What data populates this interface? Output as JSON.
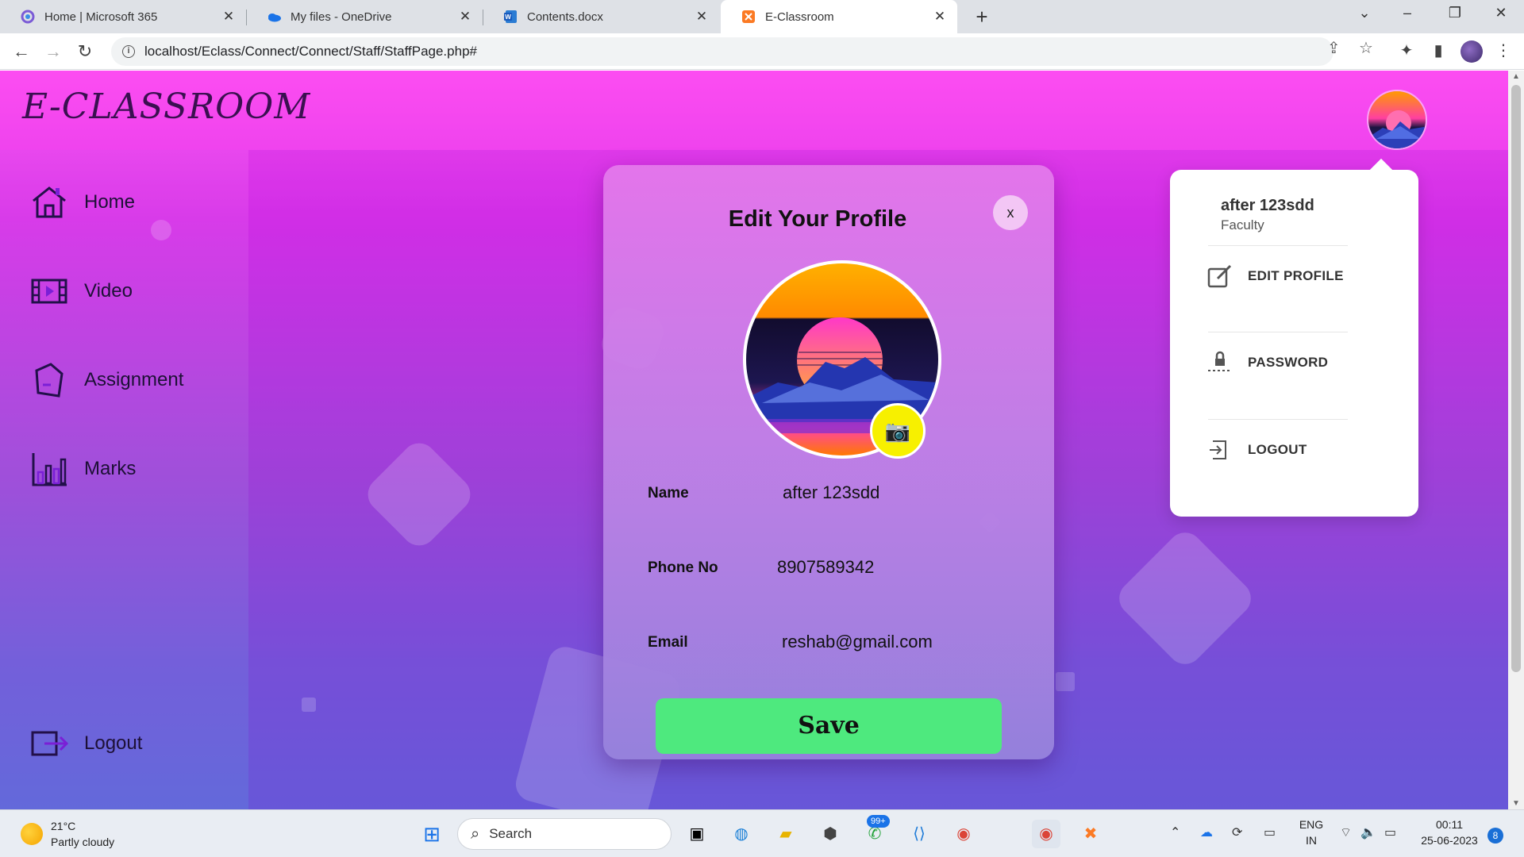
{
  "browser": {
    "tabs": [
      {
        "title": "Home | Microsoft 365",
        "active": false
      },
      {
        "title": "My files - OneDrive",
        "active": false
      },
      {
        "title": "Contents.docx",
        "active": false
      },
      {
        "title": "E-Classroom",
        "active": true
      }
    ],
    "new_tab": "+",
    "url": "localhost/Eclass/Connect/Connect/Staff/StaffPage.php#"
  },
  "app": {
    "logo": "E-CLASSROOM",
    "sidebar": [
      {
        "label": "Home",
        "icon": "home-icon"
      },
      {
        "label": "Video",
        "icon": "video-icon"
      },
      {
        "label": "Assignment",
        "icon": "assignment-icon"
      },
      {
        "label": "Marks",
        "icon": "marks-icon"
      }
    ],
    "logout_label": "Logout"
  },
  "modal": {
    "title": "Edit Your Profile",
    "close": "x",
    "fields": [
      {
        "label": "Name",
        "value": "after 123sdd"
      },
      {
        "label": "Phone No",
        "value": "8907589342"
      },
      {
        "label": "Email",
        "value": "reshab@gmail.com"
      }
    ],
    "save_label": "Save"
  },
  "dropdown": {
    "name": "after 123sdd",
    "role": "Faculty",
    "items": [
      {
        "label": "EDIT PROFILE",
        "icon": "edit-icon"
      },
      {
        "label": "PASSWORD",
        "icon": "lock-icon"
      },
      {
        "label": "LOGOUT",
        "icon": "logout-icon"
      }
    ]
  },
  "taskbar": {
    "weather_temp": "21°C",
    "weather_desc": "Partly cloudy",
    "search_label": "Search",
    "badge_count": "99+",
    "lang_top": "ENG",
    "lang_bottom": "IN",
    "time": "00:11",
    "date": "25-06-2023",
    "notifications": "8"
  },
  "colors": {
    "save_button": "#4ee97e",
    "camera_button": "#f7f000",
    "page_gradient_top": "#fb4cf2",
    "page_gradient_bottom": "#5a60d8"
  }
}
